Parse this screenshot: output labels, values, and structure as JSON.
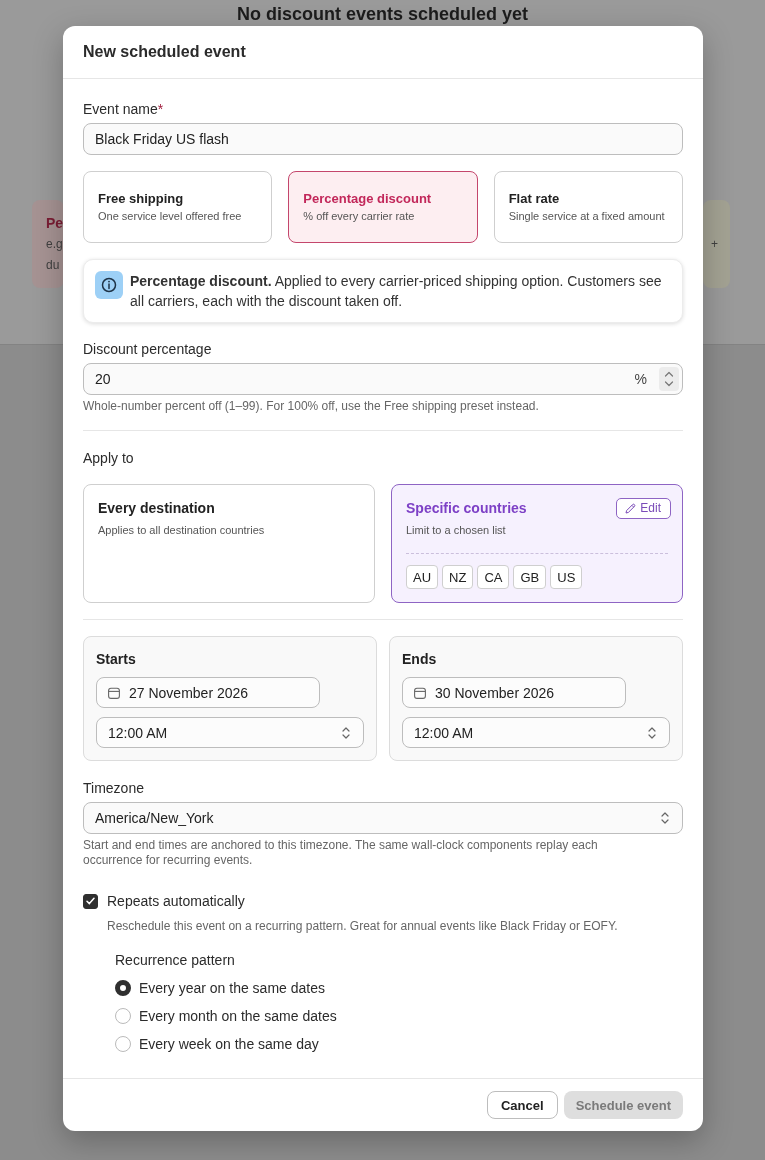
{
  "backdrop": {
    "heading": "No discount events scheduled yet",
    "cards": [
      {
        "title": "Pe",
        "lines": [
          "e.g",
          "du"
        ],
        "color": "#a69393"
      },
      {
        "lines": [
          "+"
        ],
        "color": "#a3a293"
      }
    ]
  },
  "dialog": {
    "title": "New scheduled event"
  },
  "event_name": {
    "label": "Event name",
    "required_mark": "*",
    "value": "Black Friday US flash"
  },
  "presets": [
    {
      "title": "Free shipping",
      "subtitle": "One service level offered free",
      "selected": false
    },
    {
      "title": "Percentage discount",
      "subtitle": "% off every carrier rate",
      "selected": true
    },
    {
      "title": "Flat rate",
      "subtitle": "Single service at a fixed amount",
      "selected": false
    }
  ],
  "info": {
    "text": "**Percentage discount.** Applied to every carrier-priced shipping option. Customers see all carriers, each with the discount taken off."
  },
  "discount": {
    "label": "Discount percentage",
    "value": "20",
    "suffix": "%",
    "hint": "Whole-number percent off (1–99). For 100% off, use the Free shipping preset instead."
  },
  "apply_to": {
    "label": "Apply to",
    "options": [
      {
        "title": "Every destination",
        "subtitle": "Applies to all destination countries",
        "selected": false
      },
      {
        "title": "Specific countries",
        "subtitle": "Limit to a chosen list",
        "selected": true,
        "edit_label": "Edit",
        "countries": [
          "AU",
          "NZ",
          "CA",
          "GB",
          "US"
        ]
      }
    ]
  },
  "schedule": [
    {
      "label": "Starts",
      "date": "27 November 2026",
      "time": "12:00 AM"
    },
    {
      "label": "Ends",
      "date": "30 November 2026",
      "time": "12:00 AM"
    }
  ],
  "timezone": {
    "label": "Timezone",
    "value": "America/New_York",
    "hint": "Start and end times are anchored to this timezone. The same wall-clock components replay each occurrence for recurring events."
  },
  "repeat": {
    "label": "Repeats automatically",
    "checked": true,
    "description": "Reschedule this event on a recurring pattern. Great for annual events like Black Friday or EOFY.",
    "pattern_label": "Recurrence pattern",
    "options": [
      {
        "label": "Every year on the same dates",
        "selected": true
      },
      {
        "label": "Every month on the same dates",
        "selected": false
      },
      {
        "label": "Every week on the same day",
        "selected": false
      }
    ]
  },
  "footer": {
    "buttons": [
      {
        "label": "Cancel",
        "kind": "secondary",
        "disabled": false
      },
      {
        "label": "Schedule event",
        "kind": "primary",
        "disabled": true
      }
    ]
  }
}
